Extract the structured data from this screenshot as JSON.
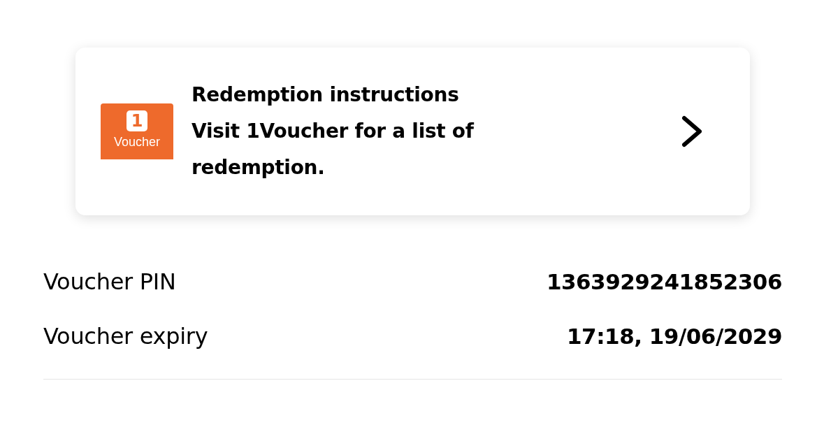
{
  "redemption_card": {
    "logo": {
      "mark": "1",
      "text": "Voucher"
    },
    "title": "Redemption instructions",
    "description": "Visit 1Voucher for a list of redemption."
  },
  "details": [
    {
      "label": "Voucher PIN",
      "value": "1363929241852306"
    },
    {
      "label": "Voucher expiry",
      "value": "17:18, 19/06/2029"
    }
  ]
}
